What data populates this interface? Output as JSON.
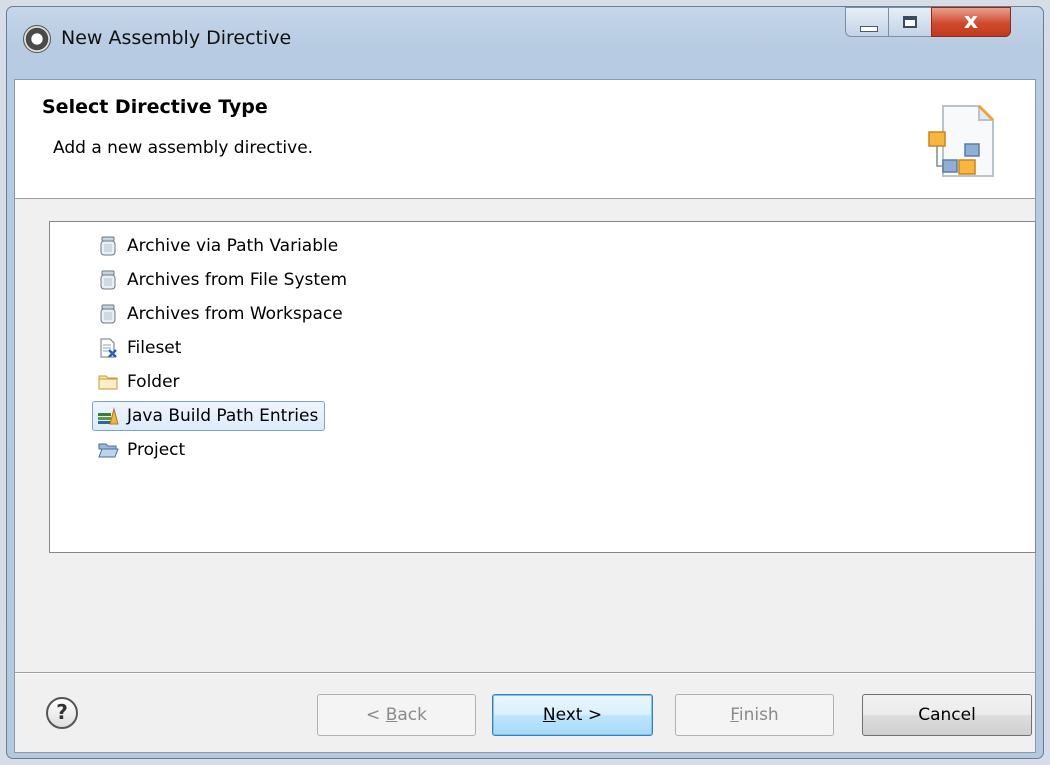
{
  "window": {
    "title": "New Assembly Directive",
    "close_glyph": "x"
  },
  "header": {
    "title": "Select Directive Type",
    "description": "Add a new assembly directive."
  },
  "directive_types": [
    {
      "label": "Archive via Path Variable",
      "icon": "jar-icon",
      "selected": false
    },
    {
      "label": "Archives from File System",
      "icon": "jar-icon",
      "selected": false
    },
    {
      "label": "Archives from Workspace",
      "icon": "jar-icon",
      "selected": false
    },
    {
      "label": "Fileset",
      "icon": "fileset-icon",
      "selected": false
    },
    {
      "label": "Folder",
      "icon": "folder-icon",
      "selected": false
    },
    {
      "label": "Java Build Path Entries",
      "icon": "library-icon",
      "selected": true
    },
    {
      "label": "Project",
      "icon": "open-folder-icon",
      "selected": false
    }
  ],
  "buttons": {
    "help": "?",
    "back_prefix": "< ",
    "back_mnemonic": "B",
    "back_rest": "ack",
    "next_mnemonic": "N",
    "next_rest": "ext >",
    "finish_mnemonic": "F",
    "finish_rest": "inish",
    "cancel": "Cancel"
  },
  "colors": {
    "selection_fill": "#dcebfc",
    "selection_border": "#7da2ce",
    "close_button": "#c13a1e",
    "default_button": "#a7d9f5"
  }
}
